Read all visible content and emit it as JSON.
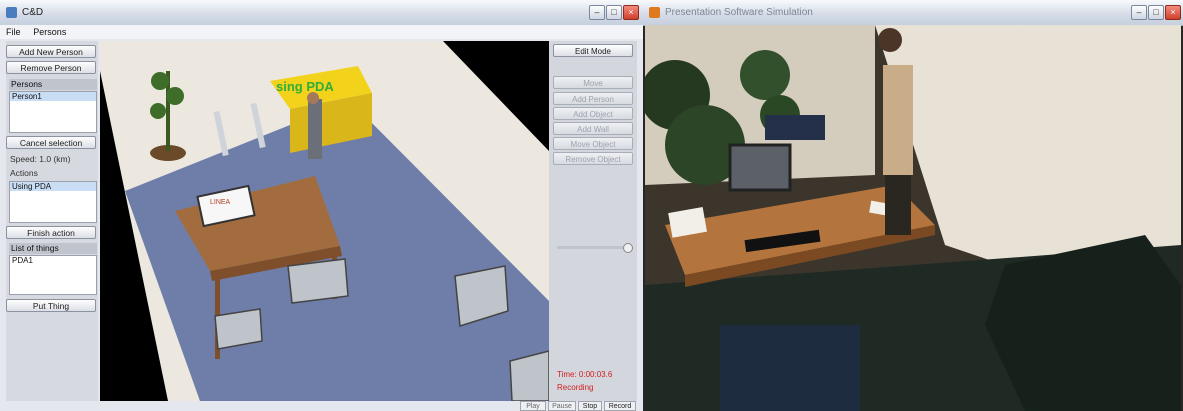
{
  "left_window": {
    "title": "C&D",
    "menu": [
      "File",
      "Persons"
    ],
    "side_panel": {
      "add_person_label": "Add New Person",
      "remove_person_label": "Remove Person",
      "persons_header": "Persons",
      "persons_items": [
        "Person1"
      ],
      "cancel_selection_label": "Cancel selection",
      "speed_text": "Speed: 1.0 (km)",
      "actions_header": "Actions",
      "actions_items": [
        "Using PDA"
      ],
      "finish_action_label": "Finish action",
      "things_header": "List of things",
      "things_items": [
        "PDA1"
      ],
      "put_thing_label": "Put Thing"
    },
    "scene": {
      "sign_text": "sing PDA",
      "monitor_text": "LINEA"
    },
    "right_panel": {
      "edit_mode_label": "Edit Mode",
      "buttons": [
        "Move",
        "Add Person",
        "Add Object",
        "Add Wall",
        "Move Object",
        "Remove Object"
      ],
      "time_text": "Time: 0:00:03.6",
      "status_text": "Recording"
    },
    "bottom_buttons": [
      "Play",
      "Pause",
      "Stop",
      "Record"
    ]
  },
  "right_window": {
    "title": "Presentation Software Simulation"
  },
  "colors": {
    "status_red": "#d22020",
    "sign_yellow": "#f2d21b",
    "sign_text_green": "#2fae3a",
    "floor_blue": "#6f7ea8"
  }
}
